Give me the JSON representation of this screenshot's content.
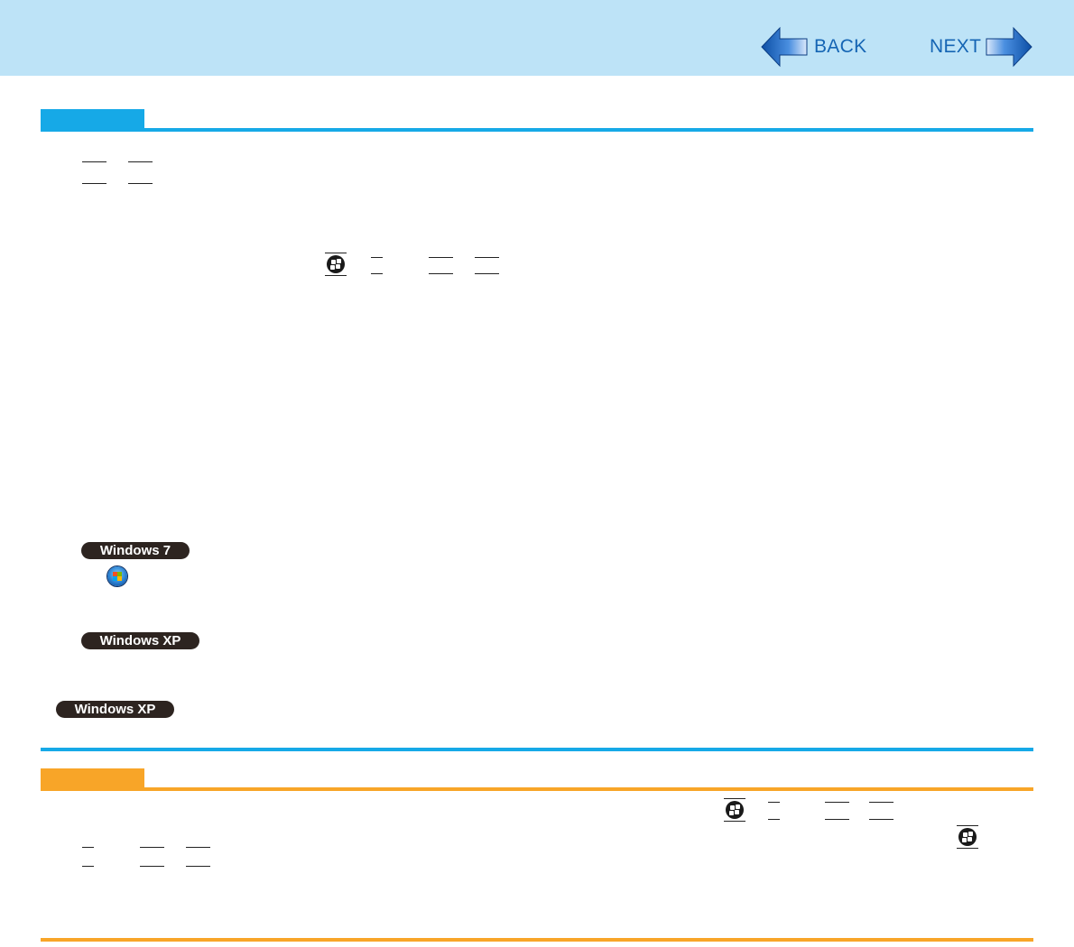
{
  "nav": {
    "back_label": "BACK",
    "next_label": "NEXT"
  },
  "badges": {
    "win7": "Windows 7",
    "winxp_1": "Windows XP",
    "winxp_2": "Windows XP"
  },
  "icons": {
    "back": "arrow-left-icon",
    "next": "arrow-right-icon",
    "windows_key": "windows-logo-icon",
    "start_orb": "windows-start-orb-icon"
  },
  "colors": {
    "header_band": "#bde3f7",
    "note_accent": "#16a9e7",
    "caution_accent": "#f8a528",
    "nav_text": "#1565b4",
    "badge_bg": "#2d2420"
  }
}
